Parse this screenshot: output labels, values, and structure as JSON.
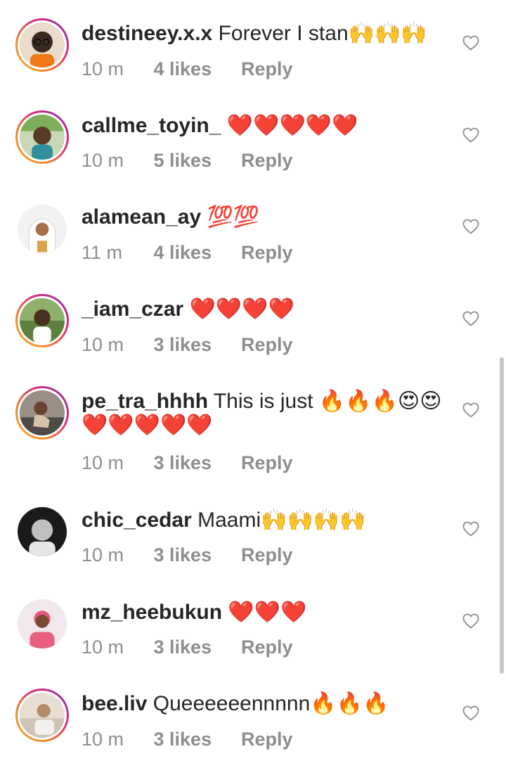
{
  "comments": [
    {
      "username": "destineey.x.x",
      "text": "Forever I stan🙌🙌🙌",
      "time": "10 m",
      "likes": "4 likes",
      "reply": "Reply",
      "story_ring": true
    },
    {
      "username": "callme_toyin_",
      "text": "❤️❤️❤️❤️❤️",
      "time": "10 m",
      "likes": "5 likes",
      "reply": "Reply",
      "story_ring": true
    },
    {
      "username": "alamean_ay",
      "text": "💯💯",
      "time": "11 m",
      "likes": "4 likes",
      "reply": "Reply",
      "story_ring": false
    },
    {
      "username": "_iam_czar",
      "text": "❤️❤️❤️❤️",
      "time": "10 m",
      "likes": "3 likes",
      "reply": "Reply",
      "story_ring": true
    },
    {
      "username": "pe_tra_hhhh",
      "text": "This is just 🔥🔥🔥😍😍❤️❤️❤️❤️❤️",
      "time": "10 m",
      "likes": "3 likes",
      "reply": "Reply",
      "story_ring": true
    },
    {
      "username": "chic_cedar",
      "text": "Maami🙌🙌🙌🙌",
      "time": "10 m",
      "likes": "3 likes",
      "reply": "Reply",
      "story_ring": false
    },
    {
      "username": "mz_heebukun",
      "text": "❤️❤️❤️",
      "time": "10 m",
      "likes": "3 likes",
      "reply": "Reply",
      "story_ring": false
    },
    {
      "username": "bee.liv",
      "text": "Queeeeeennnnn🔥🔥🔥",
      "time": "10 m",
      "likes": "3 likes",
      "reply": "Reply",
      "story_ring": true
    }
  ],
  "icons": {
    "like": "heart-outline-icon"
  },
  "colors": {
    "text": "#262626",
    "secondary": "#8e8e8e",
    "ring_start": "#f9b233",
    "ring_mid": "#dd2a7b",
    "ring_end": "#8134af"
  }
}
